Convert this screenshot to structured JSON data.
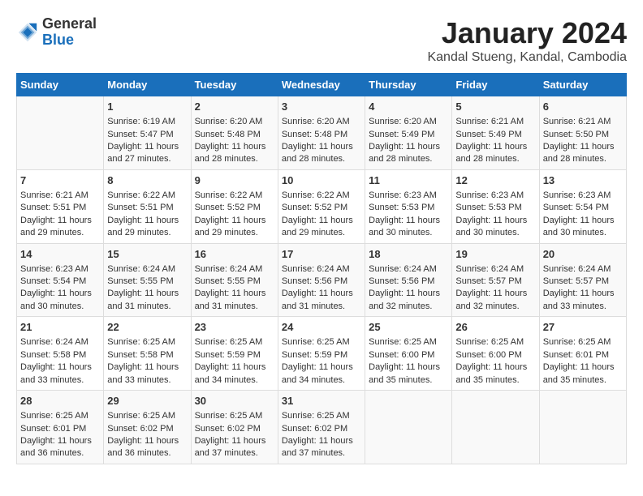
{
  "header": {
    "logo": {
      "line1": "General",
      "line2": "Blue"
    },
    "title": "January 2024",
    "subtitle": "Kandal Stueng, Kandal, Cambodia"
  },
  "calendar": {
    "columns": [
      "Sunday",
      "Monday",
      "Tuesday",
      "Wednesday",
      "Thursday",
      "Friday",
      "Saturday"
    ],
    "rows": [
      [
        {
          "day": "",
          "sunrise": "",
          "sunset": "",
          "daylight": ""
        },
        {
          "day": "1",
          "sunrise": "Sunrise: 6:19 AM",
          "sunset": "Sunset: 5:47 PM",
          "daylight": "Daylight: 11 hours and 27 minutes."
        },
        {
          "day": "2",
          "sunrise": "Sunrise: 6:20 AM",
          "sunset": "Sunset: 5:48 PM",
          "daylight": "Daylight: 11 hours and 28 minutes."
        },
        {
          "day": "3",
          "sunrise": "Sunrise: 6:20 AM",
          "sunset": "Sunset: 5:48 PM",
          "daylight": "Daylight: 11 hours and 28 minutes."
        },
        {
          "day": "4",
          "sunrise": "Sunrise: 6:20 AM",
          "sunset": "Sunset: 5:49 PM",
          "daylight": "Daylight: 11 hours and 28 minutes."
        },
        {
          "day": "5",
          "sunrise": "Sunrise: 6:21 AM",
          "sunset": "Sunset: 5:49 PM",
          "daylight": "Daylight: 11 hours and 28 minutes."
        },
        {
          "day": "6",
          "sunrise": "Sunrise: 6:21 AM",
          "sunset": "Sunset: 5:50 PM",
          "daylight": "Daylight: 11 hours and 28 minutes."
        }
      ],
      [
        {
          "day": "7",
          "sunrise": "Sunrise: 6:21 AM",
          "sunset": "Sunset: 5:51 PM",
          "daylight": "Daylight: 11 hours and 29 minutes."
        },
        {
          "day": "8",
          "sunrise": "Sunrise: 6:22 AM",
          "sunset": "Sunset: 5:51 PM",
          "daylight": "Daylight: 11 hours and 29 minutes."
        },
        {
          "day": "9",
          "sunrise": "Sunrise: 6:22 AM",
          "sunset": "Sunset: 5:52 PM",
          "daylight": "Daylight: 11 hours and 29 minutes."
        },
        {
          "day": "10",
          "sunrise": "Sunrise: 6:22 AM",
          "sunset": "Sunset: 5:52 PM",
          "daylight": "Daylight: 11 hours and 29 minutes."
        },
        {
          "day": "11",
          "sunrise": "Sunrise: 6:23 AM",
          "sunset": "Sunset: 5:53 PM",
          "daylight": "Daylight: 11 hours and 30 minutes."
        },
        {
          "day": "12",
          "sunrise": "Sunrise: 6:23 AM",
          "sunset": "Sunset: 5:53 PM",
          "daylight": "Daylight: 11 hours and 30 minutes."
        },
        {
          "day": "13",
          "sunrise": "Sunrise: 6:23 AM",
          "sunset": "Sunset: 5:54 PM",
          "daylight": "Daylight: 11 hours and 30 minutes."
        }
      ],
      [
        {
          "day": "14",
          "sunrise": "Sunrise: 6:23 AM",
          "sunset": "Sunset: 5:54 PM",
          "daylight": "Daylight: 11 hours and 30 minutes."
        },
        {
          "day": "15",
          "sunrise": "Sunrise: 6:24 AM",
          "sunset": "Sunset: 5:55 PM",
          "daylight": "Daylight: 11 hours and 31 minutes."
        },
        {
          "day": "16",
          "sunrise": "Sunrise: 6:24 AM",
          "sunset": "Sunset: 5:55 PM",
          "daylight": "Daylight: 11 hours and 31 minutes."
        },
        {
          "day": "17",
          "sunrise": "Sunrise: 6:24 AM",
          "sunset": "Sunset: 5:56 PM",
          "daylight": "Daylight: 11 hours and 31 minutes."
        },
        {
          "day": "18",
          "sunrise": "Sunrise: 6:24 AM",
          "sunset": "Sunset: 5:56 PM",
          "daylight": "Daylight: 11 hours and 32 minutes."
        },
        {
          "day": "19",
          "sunrise": "Sunrise: 6:24 AM",
          "sunset": "Sunset: 5:57 PM",
          "daylight": "Daylight: 11 hours and 32 minutes."
        },
        {
          "day": "20",
          "sunrise": "Sunrise: 6:24 AM",
          "sunset": "Sunset: 5:57 PM",
          "daylight": "Daylight: 11 hours and 33 minutes."
        }
      ],
      [
        {
          "day": "21",
          "sunrise": "Sunrise: 6:24 AM",
          "sunset": "Sunset: 5:58 PM",
          "daylight": "Daylight: 11 hours and 33 minutes."
        },
        {
          "day": "22",
          "sunrise": "Sunrise: 6:25 AM",
          "sunset": "Sunset: 5:58 PM",
          "daylight": "Daylight: 11 hours and 33 minutes."
        },
        {
          "day": "23",
          "sunrise": "Sunrise: 6:25 AM",
          "sunset": "Sunset: 5:59 PM",
          "daylight": "Daylight: 11 hours and 34 minutes."
        },
        {
          "day": "24",
          "sunrise": "Sunrise: 6:25 AM",
          "sunset": "Sunset: 5:59 PM",
          "daylight": "Daylight: 11 hours and 34 minutes."
        },
        {
          "day": "25",
          "sunrise": "Sunrise: 6:25 AM",
          "sunset": "Sunset: 6:00 PM",
          "daylight": "Daylight: 11 hours and 35 minutes."
        },
        {
          "day": "26",
          "sunrise": "Sunrise: 6:25 AM",
          "sunset": "Sunset: 6:00 PM",
          "daylight": "Daylight: 11 hours and 35 minutes."
        },
        {
          "day": "27",
          "sunrise": "Sunrise: 6:25 AM",
          "sunset": "Sunset: 6:01 PM",
          "daylight": "Daylight: 11 hours and 35 minutes."
        }
      ],
      [
        {
          "day": "28",
          "sunrise": "Sunrise: 6:25 AM",
          "sunset": "Sunset: 6:01 PM",
          "daylight": "Daylight: 11 hours and 36 minutes."
        },
        {
          "day": "29",
          "sunrise": "Sunrise: 6:25 AM",
          "sunset": "Sunset: 6:02 PM",
          "daylight": "Daylight: 11 hours and 36 minutes."
        },
        {
          "day": "30",
          "sunrise": "Sunrise: 6:25 AM",
          "sunset": "Sunset: 6:02 PM",
          "daylight": "Daylight: 11 hours and 37 minutes."
        },
        {
          "day": "31",
          "sunrise": "Sunrise: 6:25 AM",
          "sunset": "Sunset: 6:02 PM",
          "daylight": "Daylight: 11 hours and 37 minutes."
        },
        {
          "day": "",
          "sunrise": "",
          "sunset": "",
          "daylight": ""
        },
        {
          "day": "",
          "sunrise": "",
          "sunset": "",
          "daylight": ""
        },
        {
          "day": "",
          "sunrise": "",
          "sunset": "",
          "daylight": ""
        }
      ]
    ]
  }
}
